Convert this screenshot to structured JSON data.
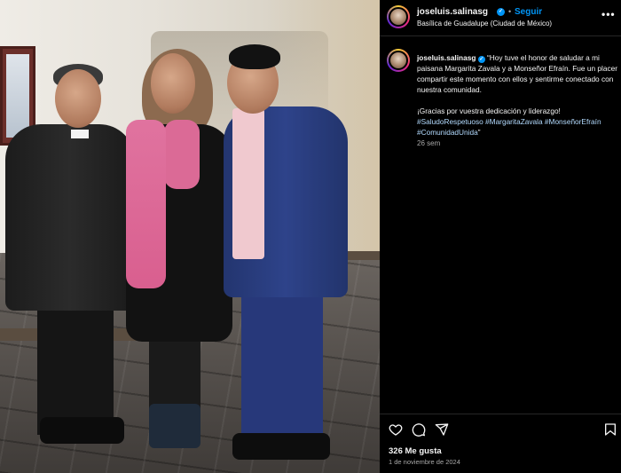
{
  "post": {
    "username": "joseluis.salinasg",
    "follow_label": "Seguir",
    "location": "Basílica de Guadalupe (Ciudad de México)",
    "more_label": "•••",
    "verified_mark": "✓",
    "separator": "•"
  },
  "caption": {
    "username": "joseluis.salinasg",
    "verified_mark": "✓",
    "text": "“Hoy tuve el honor de saludar a mi paisana Margarita Zavala y a Monseñor Efraín. Fue un placer compartir este momento con ellos y sentirme conectado con nuestra comunidad.",
    "text2": "¡Gracias por vuestra dedicación y liderazgo!",
    "hashtags": [
      "#SaludoRespetuoso",
      "#MargaritaZavala",
      "#MonseñorEfraín",
      "#ComunidadUnida"
    ],
    "closing_quote": "”",
    "time_ago": "26 sem"
  },
  "footer": {
    "likes": "326 Me gusta",
    "date": "1 de noviembre de 2024"
  },
  "icons": {
    "like": "heart-icon",
    "comment": "comment-icon",
    "share": "send-icon",
    "save": "bookmark-icon"
  },
  "colors": {
    "accent": "#0095f6",
    "background": "#000000",
    "text": "#f5f5f5",
    "secondary_text": "#a8a8a8"
  }
}
